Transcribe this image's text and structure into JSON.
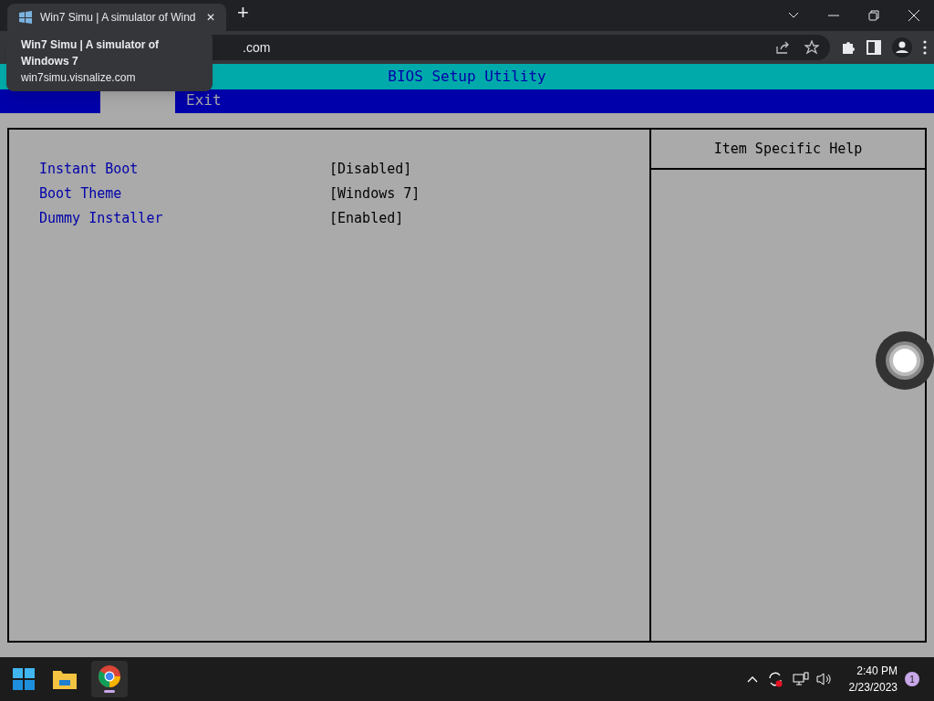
{
  "browser": {
    "tab_title": "Win7 Simu | A simulator of Wind",
    "tab_close": "✕",
    "new_tab": "+",
    "address": ".com",
    "tooltip": {
      "title": "Win7 Simu | A simulator of Windows 7",
      "url": "win7simu.visnalize.com"
    }
  },
  "bios": {
    "title": "BIOS Setup Utility",
    "tabs": [
      {
        "selected": true
      },
      {
        "label": "Exit",
        "selected": false
      }
    ],
    "items": [
      {
        "name": "Instant Boot",
        "value": "[Disabled]"
      },
      {
        "name": "Boot Theme",
        "value": "[Windows 7]"
      },
      {
        "name": "Dummy Installer",
        "value": "[Enabled]"
      }
    ],
    "help_title": "Item Specific Help"
  },
  "taskbar": {
    "time": "2:40 PM",
    "date": "2/23/2023",
    "notifications": "1"
  }
}
